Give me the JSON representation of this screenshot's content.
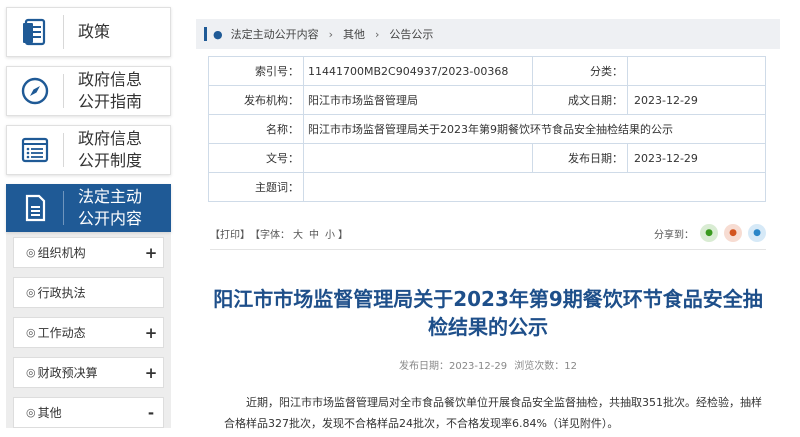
{
  "sidebar": {
    "nav": [
      {
        "label": "政策",
        "icon": "document-icon"
      },
      {
        "label": "政府信息\n公开指南",
        "icon": "compass-icon"
      },
      {
        "label": "政府信息\n公开制度",
        "icon": "list-icon"
      },
      {
        "label": "法定主动\n公开内容",
        "icon": "file-icon",
        "active": true
      }
    ],
    "sub_items": [
      {
        "label": "组织机构",
        "toggle": "+"
      },
      {
        "label": "行政执法",
        "toggle": ""
      },
      {
        "label": "工作动态",
        "toggle": "+"
      },
      {
        "label": "财政预决算",
        "toggle": "+"
      },
      {
        "label": "其他",
        "toggle": "-"
      }
    ],
    "sub_lead": "◎"
  },
  "breadcrumb": [
    "法定主动公开内容",
    "其他",
    "公告公示"
  ],
  "meta": {
    "index_label": "索引号：",
    "index_value": "11441700MB2C904937/2023-00368",
    "category_label": "分类：",
    "category_value": "",
    "publisher_label": "发布机构：",
    "publisher_value": "阳江市市场监督管理局",
    "created_label": "成文日期：",
    "created_value": "2023-12-29",
    "name_label": "名称：",
    "name_value": "阳江市市场监督管理局关于2023年第9期餐饮环节食品安全抽检结果的公示",
    "docno_label": "文号：",
    "docno_value": "",
    "published_label": "发布日期：",
    "published_value": "2023-12-29",
    "subject_label": "主题词：",
    "subject_value": ""
  },
  "tools": {
    "print": "【打印】",
    "font_prefix": "【字体：",
    "font_large": "大",
    "font_medium": "中",
    "font_small": "小",
    "font_suffix": "】",
    "share_label": "分享到："
  },
  "article": {
    "title": "阳江市市场监督管理局关于2023年第9期餐饮环节食品安全抽检结果的公示",
    "pub_date": "发布日期：2023-12-29",
    "views": "浏览次数：12",
    "body": "近期，阳江市市场监督管理局对全市食品餐饮单位开展食品安全监督抽检，共抽取351批次。经检验，抽样合格样品327批次，发现不合格样品24批次，不合格发现率6.84%（详见附件）。"
  },
  "colors": {
    "brand": "#1f5a96",
    "title": "#1e4f8a"
  }
}
